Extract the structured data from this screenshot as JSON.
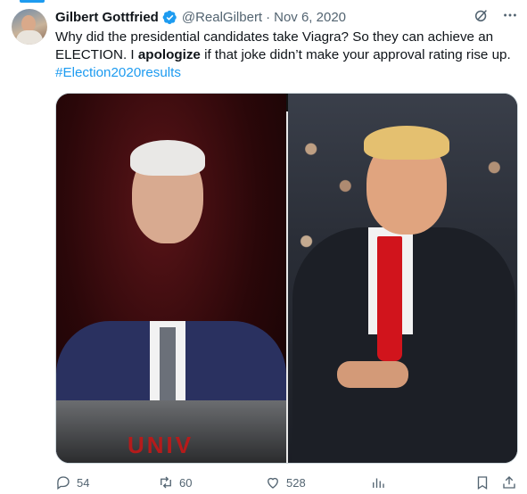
{
  "tweet": {
    "author_name": "Gilbert Gottfried",
    "handle": "@RealGilbert",
    "separator": "·",
    "date": "Nov 6, 2020",
    "text_part1": "Why did the presidential candidates take Viagra? So they can achieve an ELECTION. I ",
    "text_bold": "apologize",
    "text_part2": " if that joke didn’t make your approval rating rise up.",
    "hashtag": "#Election2020results",
    "podium_text": "UNIV"
  },
  "actions": {
    "replies": "54",
    "reposts": "60",
    "likes": "528"
  },
  "colors": {
    "accent": "#1d9bf0",
    "muted": "#536471",
    "text": "#0f1419"
  },
  "icons": [
    "verified-badge-icon",
    "grok-icon",
    "more-icon",
    "reply-icon",
    "retweet-icon",
    "like-icon",
    "views-icon",
    "bookmark-icon",
    "share-icon"
  ]
}
